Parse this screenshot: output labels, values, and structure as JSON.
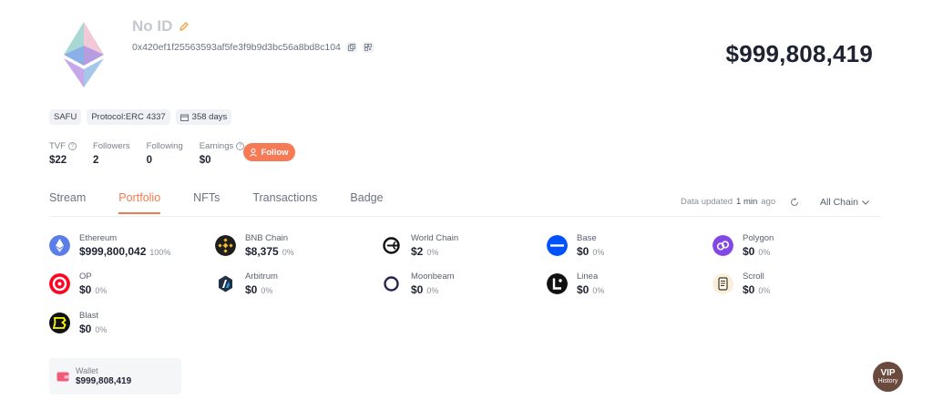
{
  "profile": {
    "name": "No ID",
    "address": "0x420ef1f25563593af5fe3f9b9d3bc56a8bd8c104",
    "total_value": "$999,808,419"
  },
  "badges": [
    "SAFU",
    "Protocol:ERC 4337",
    "358 days"
  ],
  "stats": [
    {
      "label": "TVF",
      "value": "$22"
    },
    {
      "label": "Followers",
      "value": "2"
    },
    {
      "label": "Following",
      "value": "0"
    },
    {
      "label": "Earnings",
      "value": "$0"
    }
  ],
  "follow_label": "Follow",
  "tabs": [
    "Stream",
    "Portfolio",
    "NFTs",
    "Transactions",
    "Badge"
  ],
  "active_tab": "Portfolio",
  "updated": {
    "prefix": "Data updated",
    "value": "1 min",
    "suffix": "ago"
  },
  "chain_filter": "All Chain",
  "chains": [
    {
      "name": "Ethereum",
      "amount": "$999,800,042",
      "pct": "100%",
      "icon": "ethereum-icon",
      "color": "#5b7de8"
    },
    {
      "name": "BNB Chain",
      "amount": "$8,375",
      "pct": "0%",
      "icon": "bnb-icon",
      "color": "#1e1e1e"
    },
    {
      "name": "World Chain",
      "amount": "$2",
      "pct": "0%",
      "icon": "world-chain-icon",
      "color": "#ffffff"
    },
    {
      "name": "Base",
      "amount": "$0",
      "pct": "0%",
      "icon": "base-icon",
      "color": "#0052ff"
    },
    {
      "name": "Polygon",
      "amount": "$0",
      "pct": "0%",
      "icon": "polygon-icon",
      "color": "#8247e5"
    },
    {
      "name": "OP",
      "amount": "$0",
      "pct": "0%",
      "icon": "op-icon",
      "color": "#ff0420"
    },
    {
      "name": "Arbitrum",
      "amount": "$0",
      "pct": "0%",
      "icon": "arbitrum-icon",
      "color": "#ffffff"
    },
    {
      "name": "Moonbeam",
      "amount": "$0",
      "pct": "0%",
      "icon": "moonbeam-icon",
      "color": "#ffffff"
    },
    {
      "name": "Linea",
      "amount": "$0",
      "pct": "0%",
      "icon": "linea-icon",
      "color": "#111111"
    },
    {
      "name": "Scroll",
      "amount": "$0",
      "pct": "0%",
      "icon": "scroll-icon",
      "color": "#fcefd9"
    },
    {
      "name": "Blast",
      "amount": "$0",
      "pct": "0%",
      "icon": "blast-icon",
      "color": "#111111"
    }
  ],
  "wallet": {
    "label": "Wallet",
    "value": "$999,808,419"
  },
  "vip": {
    "line1": "VIP",
    "line2": "History"
  },
  "colors": {
    "accent": "#f57a55",
    "text": "#1e2332",
    "muted": "#8a909a"
  }
}
